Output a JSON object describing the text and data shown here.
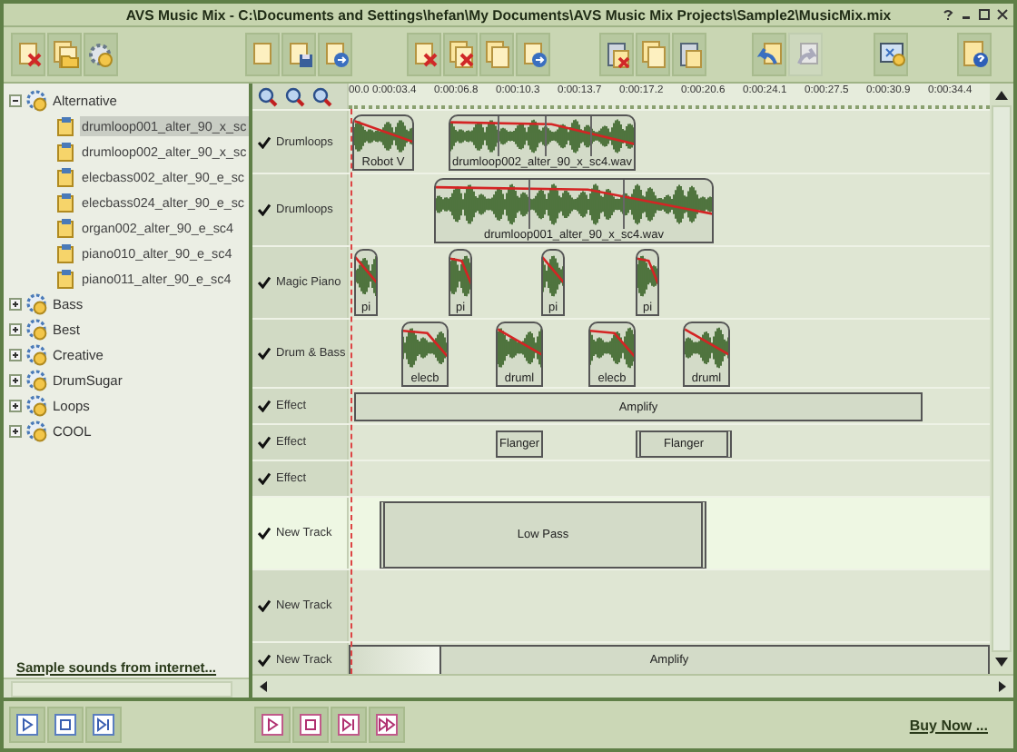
{
  "window": {
    "title": "AVS Music Mix - C:\\Documents and Settings\\hefan\\My Documents\\AVS Music Mix Projects\\Sample2\\MusicMix.mix"
  },
  "toolbar": [
    {
      "buttons": [
        {
          "disabled": false
        },
        {
          "disabled": false
        },
        {
          "disabled": false
        }
      ]
    },
    {
      "buttons": [
        {
          "disabled": false
        },
        {
          "disabled": false
        },
        {
          "disabled": false
        }
      ]
    },
    {
      "buttons": [
        {
          "disabled": false
        },
        {
          "disabled": false
        },
        {
          "disabled": false
        },
        {
          "disabled": false
        }
      ]
    },
    {
      "buttons": [
        {
          "disabled": false
        },
        {
          "disabled": false
        },
        {
          "disabled": false
        }
      ]
    },
    {
      "buttons": [
        {
          "disabled": false
        },
        {
          "disabled": true
        }
      ]
    },
    {
      "buttons": [
        {
          "disabled": false
        }
      ]
    },
    {
      "buttons": [
        {
          "disabled": false
        }
      ]
    }
  ],
  "library": {
    "folders": [
      {
        "label": "Alternative",
        "expanded": true,
        "children": [
          {
            "label": "drumloop001_alter_90_x_sc",
            "selected": true
          },
          {
            "label": "drumloop002_alter_90_x_sc",
            "selected": false
          },
          {
            "label": "elecbass002_alter_90_e_sc",
            "selected": false
          },
          {
            "label": "elecbass024_alter_90_e_sc",
            "selected": false
          },
          {
            "label": "organ002_alter_90_e_sc4",
            "selected": false
          },
          {
            "label": "piano010_alter_90_e_sc4",
            "selected": false
          },
          {
            "label": "piano011_alter_90_e_sc4",
            "selected": false
          }
        ]
      },
      {
        "label": "Bass",
        "expanded": false
      },
      {
        "label": "Best",
        "expanded": false
      },
      {
        "label": "Creative",
        "expanded": false
      },
      {
        "label": "DrumSugar",
        "expanded": false
      },
      {
        "label": "Loops",
        "expanded": false
      },
      {
        "label": "COOL",
        "expanded": false
      }
    ],
    "link": "Sample sounds from internet..."
  },
  "ruler": {
    "ticks": [
      "00.0",
      "0:00:03.4",
      "0:00:06.8",
      "0:00:10.3",
      "0:00:13.7",
      "0:00:17.2",
      "0:00:20.6",
      "0:00:24.1",
      "0:00:27.5",
      "0:00:30.9",
      "0:00:34.4"
    ]
  },
  "tracks": [
    {
      "name": "Drumloops",
      "checked": true,
      "selected": false,
      "clips": [
        {
          "kind": "audio",
          "label": "Robot V"
        },
        {
          "kind": "audio",
          "label": "drumloop002_alter_90_x_sc4.wav"
        }
      ]
    },
    {
      "name": "Drumloops",
      "checked": true,
      "selected": false,
      "clips": [
        {
          "kind": "audio",
          "label": "drumloop001_alter_90_x_sc4.wav"
        }
      ]
    },
    {
      "name": "Magic Piano",
      "checked": true,
      "selected": false,
      "clips": [
        {
          "kind": "audio",
          "label": "pi"
        },
        {
          "kind": "audio",
          "label": "pi"
        },
        {
          "kind": "audio",
          "label": "pi"
        },
        {
          "kind": "audio",
          "label": "pi"
        }
      ]
    },
    {
      "name": "Drum & Bass",
      "checked": true,
      "selected": false,
      "clips": [
        {
          "kind": "audio",
          "label": "elecb"
        },
        {
          "kind": "audio",
          "label": "druml"
        },
        {
          "kind": "audio",
          "label": "elecb"
        },
        {
          "kind": "audio",
          "label": "druml"
        }
      ]
    },
    {
      "name": "Effect",
      "checked": true,
      "selected": false,
      "clips": [
        {
          "kind": "effect",
          "label": "Amplify"
        }
      ]
    },
    {
      "name": "Effect",
      "checked": true,
      "selected": false,
      "clips": [
        {
          "kind": "effect",
          "label": "Flanger"
        },
        {
          "kind": "effect",
          "label": "Flanger"
        }
      ]
    },
    {
      "name": "Effect",
      "checked": true,
      "selected": false
    },
    {
      "name": "New Track",
      "checked": true,
      "selected": true,
      "clips": [
        {
          "kind": "effect",
          "label": "Low Pass"
        }
      ]
    },
    {
      "name": "New Track",
      "checked": true,
      "selected": false
    },
    {
      "name": "New Track",
      "checked": true,
      "selected": false,
      "clips": [
        {
          "kind": "effect",
          "label": "Amplify"
        }
      ]
    }
  ],
  "buy_link": "Buy Now ..."
}
